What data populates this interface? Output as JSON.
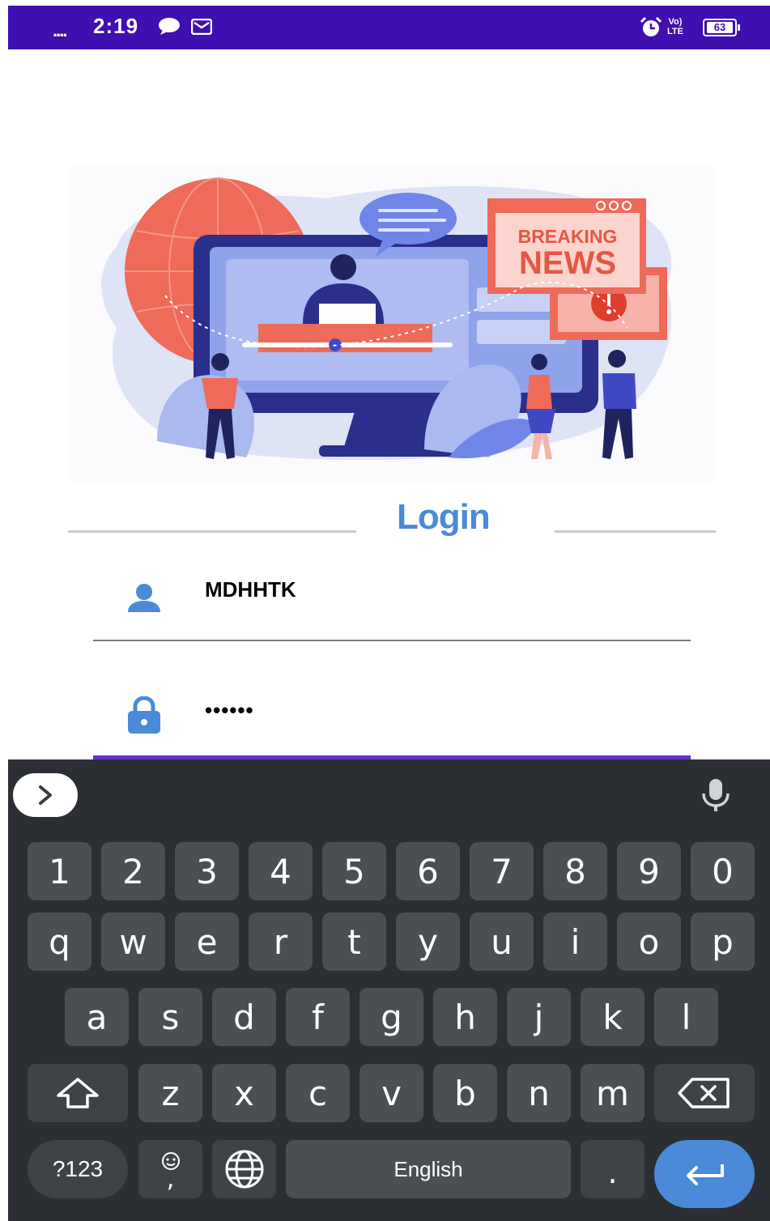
{
  "status_bar": {
    "signal": "....",
    "time": "2:19",
    "volte_top": "Vo)",
    "volte_bottom": "LTE",
    "battery": "63"
  },
  "login": {
    "title": "Login",
    "username_value": "MDHHTK",
    "password_mask": "••••••"
  },
  "hero": {
    "headline_line1": "BREAKING",
    "headline_line2": "NEWS"
  },
  "keyboard": {
    "rows": [
      [
        "1",
        "2",
        "3",
        "4",
        "5",
        "6",
        "7",
        "8",
        "9",
        "0"
      ],
      [
        "q",
        "w",
        "e",
        "r",
        "t",
        "y",
        "u",
        "i",
        "o",
        "p"
      ],
      [
        "a",
        "s",
        "d",
        "f",
        "g",
        "h",
        "j",
        "k",
        "l"
      ],
      [
        "z",
        "x",
        "c",
        "v",
        "b",
        "n",
        "m"
      ]
    ],
    "symbols_label": "?123",
    "comma_label": ",",
    "space_label": "English",
    "period_label": "."
  },
  "colors": {
    "status_bar": "#3f0fb0",
    "accent": "#4a8ad8",
    "focus_underline": "#6a2fd0",
    "keyboard_bg": "#2b2f33",
    "key_bg": "#4b4f54"
  }
}
